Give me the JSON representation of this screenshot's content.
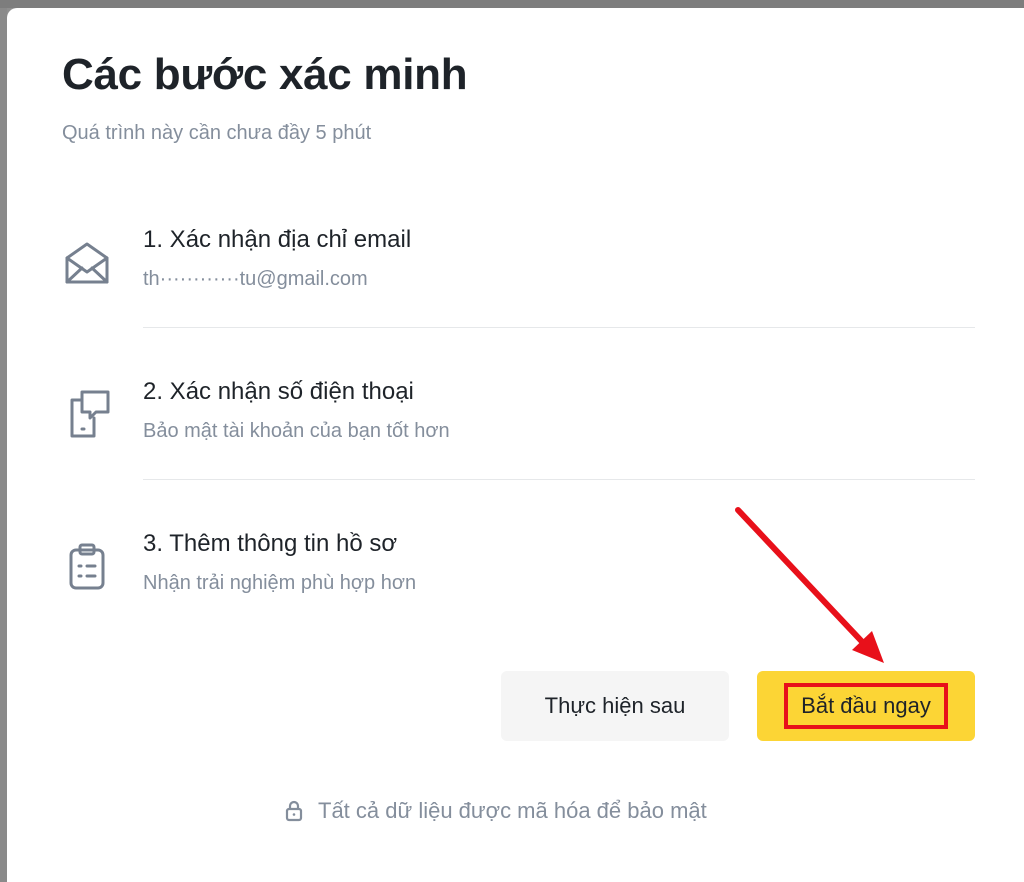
{
  "modal": {
    "title": "Các bước xác minh",
    "subtitle": "Quá trình này cần chưa đầy 5 phút"
  },
  "steps": [
    {
      "title": "1. Xác nhận địa chỉ email",
      "description": "th············tu@gmail.com",
      "icon": "envelope-icon"
    },
    {
      "title": "2. Xác nhận số điện thoại",
      "description": "Bảo mật tài khoản của bạn tốt hơn",
      "icon": "phone-chat-icon"
    },
    {
      "title": "3. Thêm thông tin hồ sơ",
      "description": "Nhận trải nghiệm phù hợp hơn",
      "icon": "clipboard-icon"
    }
  ],
  "buttons": {
    "later_label": "Thực hiện sau",
    "start_label": "Bắt đầu ngay"
  },
  "footer": {
    "security_note": "Tất cả dữ liệu được mã hóa để bảo mật",
    "icon": "lock-icon"
  },
  "colors": {
    "primary_button": "#fcd535",
    "secondary_button": "#f5f5f5",
    "title_text": "#1e2329",
    "muted_text": "#848e9c",
    "annotation_red": "#e8101a"
  }
}
